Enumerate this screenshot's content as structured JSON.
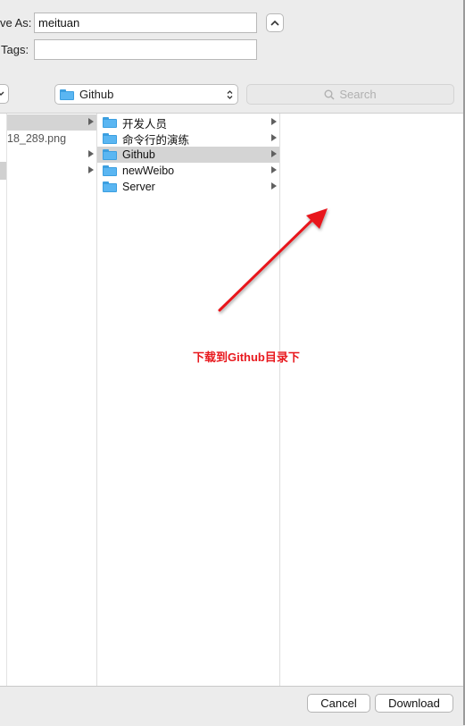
{
  "save_as": {
    "label": "ve As:",
    "value": "meituan"
  },
  "tags": {
    "label": "Tags:",
    "value": ""
  },
  "toolbar": {
    "location": "Github",
    "search_placeholder": "Search"
  },
  "columns": {
    "first": {
      "items": [
        {
          "label": ""
        },
        {
          "label": "18_289.png"
        },
        {
          "label": ""
        },
        {
          "label": ""
        }
      ]
    },
    "second": {
      "items": [
        {
          "label": "开发人员"
        },
        {
          "label": "命令行的演练"
        },
        {
          "label": "Github",
          "selected": true
        },
        {
          "label": "newWeibo"
        },
        {
          "label": "Server"
        }
      ]
    }
  },
  "annotation": {
    "text": "下载到Github目录下",
    "color": "#e8191e"
  },
  "buttons": {
    "cancel": "Cancel",
    "download": "Download"
  }
}
